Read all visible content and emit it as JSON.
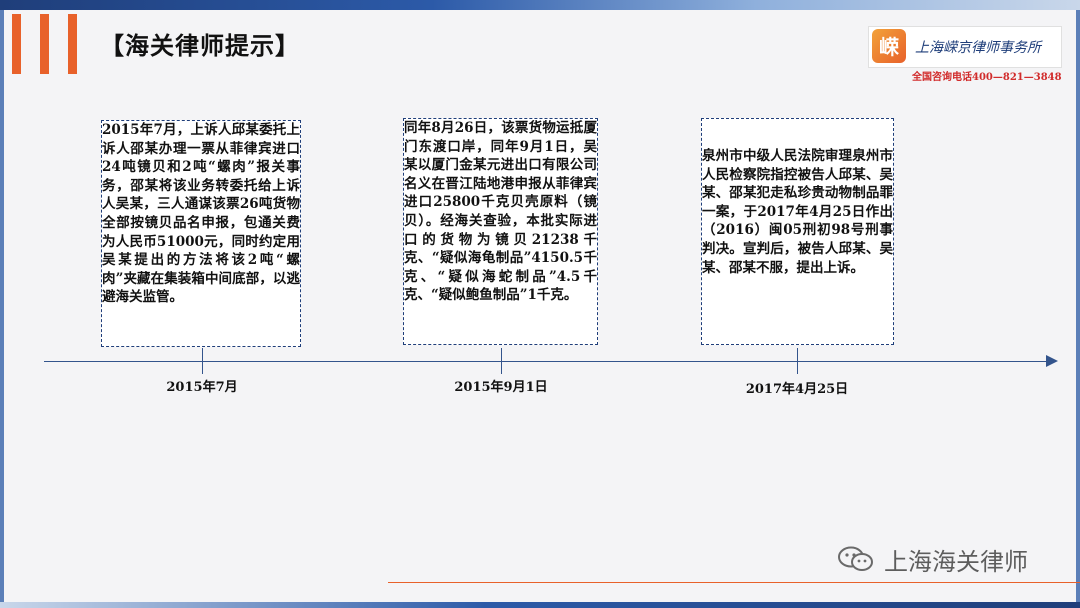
{
  "header": {
    "title": "【海关律师提示】",
    "logo_text": "上海嵘京律师事务所",
    "logo_glyph": "嵘",
    "hotline": "全国咨询电话400—821—3848"
  },
  "timeline": [
    {
      "text": "2015年7月，上诉人邱某委托上诉人邵某办理一票从菲律宾进口24吨镜贝和2吨“螺肉”报关事务，邵某将该业务转委托给上诉人吴某，三人通谋该票26吨货物全部按镜贝品名申报，包通关费为人民币51000元，同时约定用吴某提出的方法将该2吨“螺肉”夹藏在集装箱中间底部，以逃避海关监管。",
      "date": "2015年7月"
    },
    {
      "text": "同年8月26日，该票货物运抵厦门东渡口岸，同年9月1日，吴某以厦门金某元进出口有限公司名义在晋江陆地港申报从菲律宾进口25800千克贝壳原料（镜贝）。经海关查验，本批实际进口的货物为镜贝21238千克、“疑似海龟制品”4150.5千克、“疑似海蛇制品”4.5千克、“疑似鲍鱼制品”1千克。",
      "date": "2015年9月1日"
    },
    {
      "text": "泉州市中级人民法院审理泉州市人民检察院指控被告人邱某、吴某、邵某犯走私珍贵动物制品罪一案，于2017年4月25日作出（2016）闽05刑初98号刑事判决。宣判后，被告人邱某、吴某、邵某不服，提出上诉。",
      "date": "2017年4月25日"
    }
  ],
  "watermark": {
    "text": "上海海关律师",
    "icon": "wechat-icon"
  },
  "colors": {
    "accent": "#e8612a",
    "axis": "#33548c",
    "hotline": "#d12b2b"
  }
}
